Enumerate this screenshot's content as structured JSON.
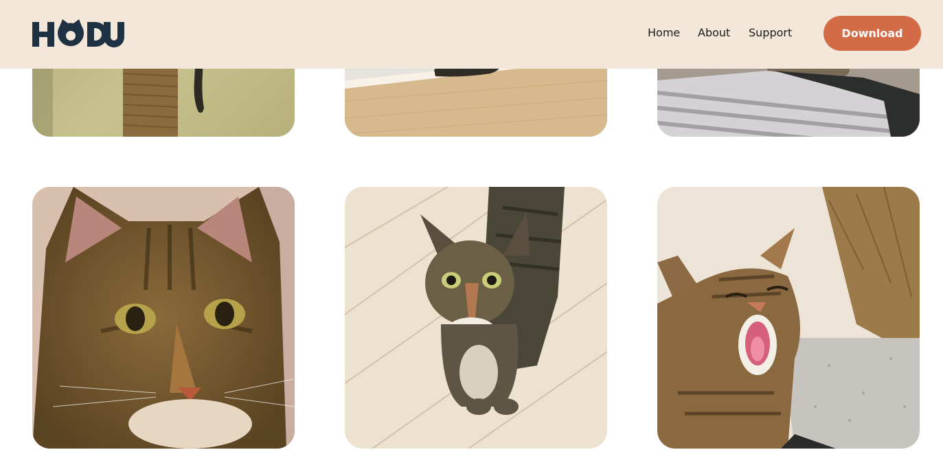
{
  "header": {
    "logo_text": "HODU",
    "logo_icon": "cat-ear-logo"
  },
  "nav": {
    "home": "Home",
    "about": "About",
    "support": "Support"
  },
  "cta": {
    "download_label": "Download"
  },
  "colors": {
    "header_bg": "#f2e7d8",
    "accent": "#d46b47",
    "logo": "#1f3244"
  },
  "gallery": {
    "photos": [
      {
        "subject": "cat-tail-scratching-post-photo"
      },
      {
        "subject": "cat-on-wood-floor-photo"
      },
      {
        "subject": "cat-on-striped-blanket-photo"
      },
      {
        "subject": "cat-closeup-face-photo"
      },
      {
        "subject": "cat-looking-up-photo"
      },
      {
        "subject": "cat-yawning-in-sun-photo"
      }
    ]
  }
}
